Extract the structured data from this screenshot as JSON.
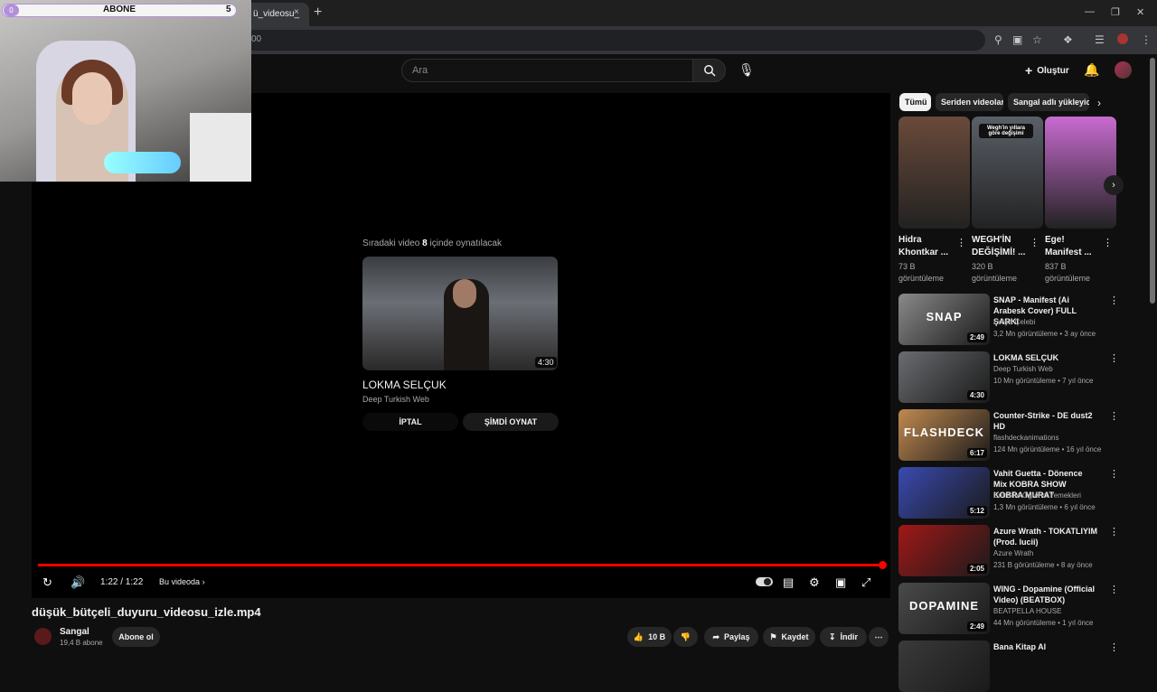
{
  "browser": {
    "tab_title": "ü_videosu_",
    "tab_close": "×",
    "new_tab": "+",
    "url_fragment": "00"
  },
  "header": {
    "search_placeholder": "Ara",
    "create_label": "Oluştur"
  },
  "overlay": {
    "sub_goal_label": "ABONE",
    "sub_goal_left": "0",
    "sub_goal_right": "5"
  },
  "player": {
    "up_next_prefix": "Sıradaki video ",
    "up_next_seconds": "8",
    "up_next_suffix": " içinde oynatılacak",
    "next_video": {
      "title": "LOKMA SELÇUK",
      "channel": "Deep Turkish Web",
      "duration": "4:30"
    },
    "cancel_label": "İPTAL",
    "play_now_label": "ŞİMDİ OYNAT",
    "time": "1:22 / 1:22",
    "progress": 1.0,
    "chapter_label": "Bu videoda"
  },
  "video": {
    "title": "düşük_bütçeli_duyuru_videosu_izle.mp4",
    "channel": "Sangal",
    "subscribers": "19,4 B abone",
    "subscribe_label": "Abone ol",
    "likes": "10 B",
    "share_label": "Paylaş",
    "save_label": "Kaydet",
    "download_label": "İndir"
  },
  "chips": [
    "Tümü",
    "Seriden videolar",
    "Sangal adlı yükleyiciden"
  ],
  "shorts": [
    {
      "title": "Hidra Khontkar ...",
      "views": "73 B görüntüleme",
      "color": "#6a4a3a",
      "overlay": ""
    },
    {
      "title": "WEGH'İN DEĞİŞİMİ! ...",
      "views": "320 B görüntüleme",
      "color": "#5a6068",
      "overlay": "Wegh'in yıllara göre değişimi"
    },
    {
      "title": "Ege! Manifest ...",
      "views": "837 B görüntüleme",
      "color": "#c86bd0",
      "overlay": ""
    }
  ],
  "related": [
    {
      "title": "SNAP - Manifest (Ai Arabesk Cover) FULL ŞARKI",
      "channel": "Evliya Çelebi",
      "meta": "3,2 Mn görüntüleme • 3 ay önce",
      "duration": "2:49",
      "color": "#8a8a8a",
      "label": "SNAP"
    },
    {
      "title": "LOKMA SELÇUK",
      "channel": "Deep Turkish Web",
      "meta": "10 Mn görüntüleme • 7 yıl önce",
      "duration": "4:30",
      "color": "#6a6c70",
      "label": ""
    },
    {
      "title": "Counter-Strike - DE dust2 HD",
      "channel": "flashdeckanimations",
      "meta": "124 Mn görüntüleme • 16 yıl önce",
      "duration": "6:17",
      "color": "#c08a50",
      "label": "FLASHDECK"
    },
    {
      "title": "Vahit Guetta - Dönence Mix KOBRA SHOW KOBRA MURAT",
      "channel": "Emre İle Öğrenci Yemekleri",
      "meta": "1,3 Mn görüntüleme • 6 yıl önce",
      "duration": "5:12",
      "color": "#3a4ab0",
      "label": ""
    },
    {
      "title": "Azure Wrath - TOKATLIYIM (Prod. lucii)",
      "channel": "Azure Wrath",
      "meta": "231 B görüntüleme • 8 ay önce",
      "duration": "2:05",
      "color": "#a01818",
      "label": ""
    },
    {
      "title": "WING - Dopamine (Official Video) (BEATBOX)",
      "channel": "BEATPELLA HOUSE",
      "meta": "44 Mn görüntüleme • 1 yıl önce",
      "duration": "2:49",
      "color": "#4a4a4a",
      "label": "DOPAMINE"
    },
    {
      "title": "Bana Kitap Al",
      "channel": "",
      "meta": "",
      "duration": "",
      "color": "#3a3a3a",
      "label": ""
    }
  ]
}
